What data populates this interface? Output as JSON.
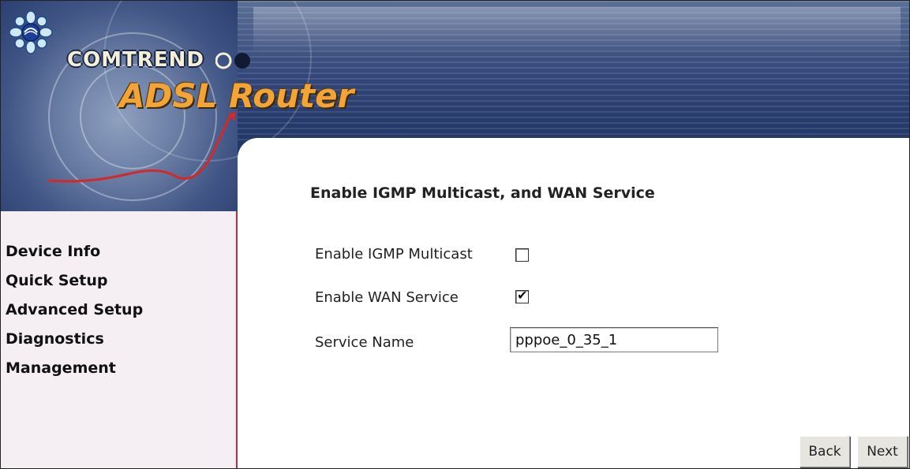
{
  "brand": {
    "logo_text": "COMTREND",
    "product_title": "ADSL Router"
  },
  "sidebar": {
    "items": [
      {
        "label": "Device Info"
      },
      {
        "label": "Quick Setup"
      },
      {
        "label": "Advanced Setup"
      },
      {
        "label": "Diagnostics"
      },
      {
        "label": "Management"
      }
    ]
  },
  "form": {
    "heading": "Enable IGMP Multicast, and WAN Service",
    "igmp": {
      "label": "Enable IGMP Multicast",
      "checked": false
    },
    "wan": {
      "label": "Enable WAN Service",
      "checked": true
    },
    "service_name": {
      "label": "Service Name",
      "value": "pppoe_0_35_1"
    }
  },
  "buttons": {
    "back": "Back",
    "next": "Next"
  },
  "colors": {
    "banner_blue": "#243a6a",
    "accent_red": "#c8263a",
    "title_orange": "#f2a437",
    "sidebar_bg": "#f5eef2"
  }
}
